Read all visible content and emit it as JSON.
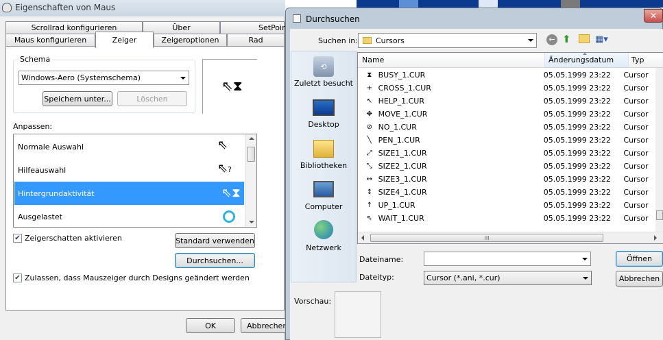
{
  "mouse": {
    "title": "Eigenschaften von Maus",
    "tabs_row1": [
      "Scrollrad konfigurieren",
      "Über",
      "SetPoint"
    ],
    "tabs_row2": [
      "Maus konfigurieren",
      "Zeiger",
      "Zeigeroptionen",
      "Rad"
    ],
    "schema_label": "Schema",
    "schema_value": "Windows-Aero (Systemschema)",
    "save_as": "Speichern unter...",
    "delete": "Löschen",
    "customize_label": "Anpassen:",
    "cursor_list": [
      {
        "label": "Normale Auswahl",
        "icon": "arrow-cursor-icon",
        "glyph": "⇖"
      },
      {
        "label": "Hilfeauswahl",
        "icon": "help-cursor-icon",
        "glyph": "⇖?"
      },
      {
        "label": "Hintergrundaktivität",
        "icon": "working-cursor-icon",
        "glyph": "⇖⧗"
      },
      {
        "label": "Ausgelastet",
        "icon": "busy-ring-icon",
        "glyph": "◯"
      }
    ],
    "shadow_label": "Zeigerschatten aktivieren",
    "default_button": "Standard verwenden",
    "browse_button": "Durchsuchen...",
    "themes_label": "Zulassen, dass Mauszeiger durch Designs geändert werden",
    "ok": "OK",
    "cancel": "Abbrechen"
  },
  "browse": {
    "title": "Durchsuchen",
    "look_in_label": "Suchen in:",
    "look_in_value": "Cursors",
    "places": [
      {
        "label": "Zuletzt besucht",
        "icon": "recent-places-icon"
      },
      {
        "label": "Desktop",
        "icon": "desktop-icon"
      },
      {
        "label": "Bibliotheken",
        "icon": "libraries-icon"
      },
      {
        "label": "Computer",
        "icon": "computer-icon"
      },
      {
        "label": "Netzwerk",
        "icon": "network-icon"
      }
    ],
    "columns": [
      "Name",
      "Änderungsdatum",
      "Typ"
    ],
    "files": [
      {
        "name": "BUSY_1.CUR",
        "date": "05.05.1999 23:22",
        "type": "Cursor",
        "glyph": "⧗"
      },
      {
        "name": "CROSS_1.CUR",
        "date": "05.05.1999 23:22",
        "type": "Cursor",
        "glyph": "+"
      },
      {
        "name": "HELP_1.CUR",
        "date": "05.05.1999 23:22",
        "type": "Cursor",
        "glyph": "↖"
      },
      {
        "name": "MOVE_1.CUR",
        "date": "05.05.1999 23:22",
        "type": "Cursor",
        "glyph": "✥"
      },
      {
        "name": "NO_1.CUR",
        "date": "05.05.1999 23:22",
        "type": "Cursor",
        "glyph": "⊘"
      },
      {
        "name": "PEN_1.CUR",
        "date": "05.05.1999 23:22",
        "type": "Cursor",
        "glyph": "╲"
      },
      {
        "name": "SIZE1_1.CUR",
        "date": "05.05.1999 23:22",
        "type": "Cursor",
        "glyph": "⤢"
      },
      {
        "name": "SIZE2_1.CUR",
        "date": "05.05.1999 23:22",
        "type": "Cursor",
        "glyph": "⤡"
      },
      {
        "name": "SIZE3_1.CUR",
        "date": "05.05.1999 23:22",
        "type": "Cursor",
        "glyph": "↔"
      },
      {
        "name": "SIZE4_1.CUR",
        "date": "05.05.1999 23:22",
        "type": "Cursor",
        "glyph": "↕"
      },
      {
        "name": "UP_1.CUR",
        "date": "05.05.1999 23:22",
        "type": "Cursor",
        "glyph": "↑"
      },
      {
        "name": "WAIT_1.CUR",
        "date": "05.05.1999 23:22",
        "type": "Cursor",
        "glyph": "⇖"
      }
    ],
    "scroll_grip": "III",
    "filename_label": "Dateiname:",
    "filename_value": "",
    "filetype_label": "Dateityp:",
    "filetype_value": "Cursor (*.ani, *.cur)",
    "open": "Öffnen",
    "cancel": "Abbrechen",
    "preview_label": "Vorschau:"
  },
  "colors": {
    "selection": "#3399ff",
    "titlebar": "#bfcddb",
    "close": "#c75050"
  }
}
